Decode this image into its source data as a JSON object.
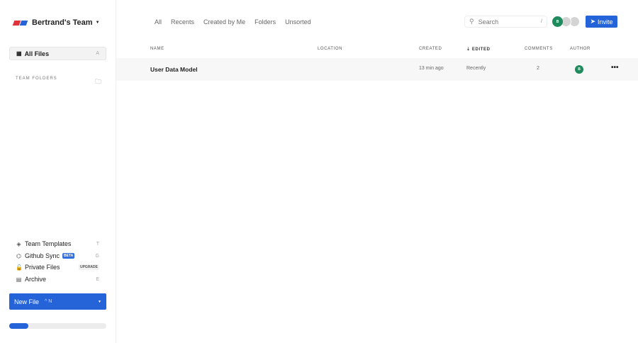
{
  "sidebar": {
    "team_name": "Bertrand's Team",
    "all_files": "All Files",
    "all_files_key": "A",
    "team_folders": "TEAM FOLDERS",
    "items": [
      {
        "label": "Team Templates",
        "key": "T"
      },
      {
        "label": "Github Sync",
        "badge": "BETA",
        "key": "G"
      },
      {
        "label": "Private Files",
        "badge": "UPGRADE"
      },
      {
        "label": "Archive",
        "key": "E"
      }
    ],
    "new_file": "New File",
    "new_file_key": "^ N",
    "usage_percent": 20
  },
  "tabs": [
    "All",
    "Recents",
    "Created by Me",
    "Folders",
    "Unsorted"
  ],
  "search": {
    "placeholder": "Search",
    "shortcut": "/"
  },
  "avatars": [
    {
      "initial": "B",
      "color": "#1f8a5b"
    },
    {
      "initial": "",
      "color": "#d4d4d4"
    },
    {
      "initial": "",
      "color": "#d4d4d4"
    }
  ],
  "invite": "Invite",
  "table": {
    "headers": {
      "name": "NAME",
      "location": "LOCATION",
      "created": "CREATED",
      "edited": "EDITED",
      "comments": "COMMENTS",
      "author": "AUTHOR"
    },
    "rows": [
      {
        "name": "User Data Model",
        "location": "",
        "created": "13 min ago",
        "edited": "Recently",
        "comments": "2",
        "author": "B"
      }
    ]
  }
}
